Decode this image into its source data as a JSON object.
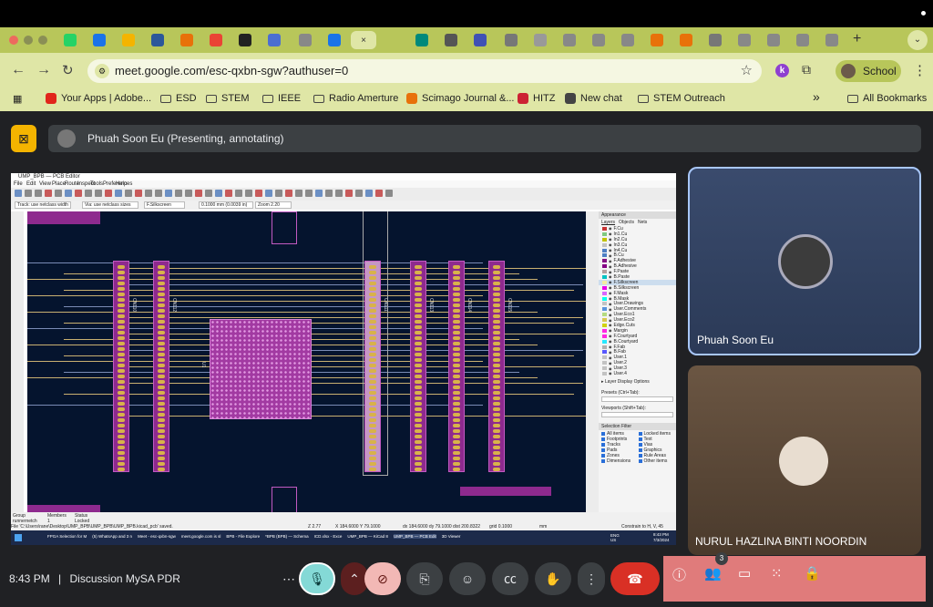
{
  "browser": {
    "url": "meet.google.com/esc-qxbn-sgw?authuser=0",
    "profile_label": "School",
    "profile_initial": "k",
    "active_tab_close": "×",
    "new_tab": "+",
    "tab_favicons": [
      "WhatsApp",
      "Drive",
      "Slides",
      "Word",
      "Scimago",
      "Gmail",
      "Wix",
      "Forms",
      "Chrome",
      "Calendar",
      "Meet",
      "Camera",
      "Settings",
      "Ext",
      "Tool",
      "Chrome",
      "Chrome",
      "Chrome",
      "Etsy",
      "Etsy",
      "Ext",
      "Chrome",
      "Chrome",
      "Chrome",
      "Chrome"
    ]
  },
  "bookmarks": [
    {
      "label": "Your Apps | Adobe...",
      "icon": "adobe-icon"
    },
    {
      "label": "ESD",
      "icon": "folder-icon"
    },
    {
      "label": "STEM",
      "icon": "folder-icon"
    },
    {
      "label": "IEEE",
      "icon": "folder-icon"
    },
    {
      "label": "Radio Amerture",
      "icon": "folder-icon"
    },
    {
      "label": "Scimago Journal &...",
      "icon": "sjr-icon"
    },
    {
      "label": "HITZ",
      "icon": "hitz-icon"
    },
    {
      "label": "New chat",
      "icon": "chatgpt-icon"
    },
    {
      "label": "STEM Outreach",
      "icon": "folder-icon"
    }
  ],
  "bookmarks_more": "»",
  "all_bookmarks": "All Bookmarks",
  "meet": {
    "presenter_banner": "Phuah Soon Eu (Presenting, annotating)",
    "participants": [
      {
        "name": "Phuah Soon Eu"
      },
      {
        "name": "NURUL HAZLINA BINTI NOORDIN"
      }
    ],
    "time": "8:43 PM",
    "separator": "|",
    "meeting_name": "Discussion MySA PDR",
    "people_count": "3"
  },
  "kicad": {
    "title": "UMP_BPB — PCB Editor",
    "menu": [
      "File",
      "Edit",
      "View",
      "Place",
      "Route",
      "Inspect",
      "Tools",
      "Preferences",
      "Help"
    ],
    "track_select": "Track: use netclass width",
    "via_select": "Via: use netclass sizes",
    "layer_select": "F.Silkscreen",
    "grid_select": "0.1000 mm (0.0039 in)",
    "zoom_select": "Zoom 2.20",
    "appearance_title": "Appearance",
    "appearance_tabs": [
      "Layers",
      "Objects",
      "Nets"
    ],
    "layers": [
      {
        "name": "F.Cu",
        "color": "#c83434"
      },
      {
        "name": "In1.Cu",
        "color": "#7fc87f"
      },
      {
        "name": "In2.Cu",
        "color": "#c2c200"
      },
      {
        "name": "In3.Cu",
        "color": "#c2c2c2"
      },
      {
        "name": "In4.Cu",
        "color": "#4d7fc4"
      },
      {
        "name": "B.Cu",
        "color": "#4d7fc4"
      },
      {
        "name": "F.Adhesive",
        "color": "#841384"
      },
      {
        "name": "B.Adhesive",
        "color": "#840084"
      },
      {
        "name": "F.Paste",
        "color": "#b4a0a0"
      },
      {
        "name": "B.Paste",
        "color": "#00c2c2"
      },
      {
        "name": "F.Silkscreen",
        "color": "#f2eda1"
      },
      {
        "name": "B.Silkscreen",
        "color": "#e800e8"
      },
      {
        "name": "F.Mask",
        "color": "#d864ff"
      },
      {
        "name": "B.Mask",
        "color": "#02ffee"
      },
      {
        "name": "User.Drawings",
        "color": "#c2c2c2"
      },
      {
        "name": "User.Comments",
        "color": "#5994dc"
      },
      {
        "name": "User.Eco1",
        "color": "#b4db81"
      },
      {
        "name": "User.Eco2",
        "color": "#d8c852"
      },
      {
        "name": "Edge.Cuts",
        "color": "#d0d210"
      },
      {
        "name": "Margin",
        "color": "#ff26e2"
      },
      {
        "name": "F.Courtyard",
        "color": "#ff26e2"
      },
      {
        "name": "B.Courtyard",
        "color": "#26e9ff"
      },
      {
        "name": "F.Fab",
        "color": "#afafaf"
      },
      {
        "name": "B.Fab",
        "color": "#5858ff"
      },
      {
        "name": "User.1",
        "color": "#c2c2c2"
      },
      {
        "name": "User.2",
        "color": "#c2c2c2"
      },
      {
        "name": "User.3",
        "color": "#c2c2c2"
      },
      {
        "name": "User.4",
        "color": "#c2c2c2"
      }
    ],
    "layer_display_options": "▸ Layer Display Options",
    "presets_label": "Presets (Ctrl+Tab):",
    "viewports_label": "Viewports (Shift+Tab):",
    "selection_filter_title": "Selection Filter",
    "selection_filter": [
      "All items",
      "Locked items",
      "Footprints",
      "Text",
      "Tracks",
      "Vias",
      "Pads",
      "Graphics",
      "Zones",
      "Rule Areas",
      "Dimensions",
      "Other items"
    ],
    "connectors": [
      "CN110",
      "CN112",
      "U1",
      "CN111",
      "CN113",
      "CN114",
      "CN115"
    ],
    "status_labels": [
      "Group",
      "Members",
      "Status"
    ],
    "status_values": [
      "runnernetch",
      "1",
      "Locked"
    ],
    "file_saved": "File 'C:\\Users\\rane\\Desktop\\UMP_BPB\\UMP_BPB\\UMP_BPB.kicad_pcb' saved.",
    "status_z": "Z 2.77",
    "status_xy": "X 184.6000 Y 79.1000",
    "status_dxdy": "dx 184.6000 dy 79.1000 dist 200.8322",
    "status_grid": "grid 0.1000",
    "status_units": "mm",
    "status_constrain": "Constrain to H, V, 45",
    "taskbar": [
      "FPGA Selection for M",
      "(5) WhatsApp and 3 n",
      "Meet - esc-qxbn-sgw",
      "meet.google.com is sl",
      "BPB - File Explore",
      "*BPB (BPB) — Schema",
      "ICD.xlsx - Exce",
      "UMP_BPB — KiCad 8",
      "UMP_BPB — PCB Edit",
      "3D Viewer"
    ],
    "taskbar_lang": "ENG US",
    "taskbar_time": "8:43 PM",
    "taskbar_date": "7/3/2024"
  }
}
